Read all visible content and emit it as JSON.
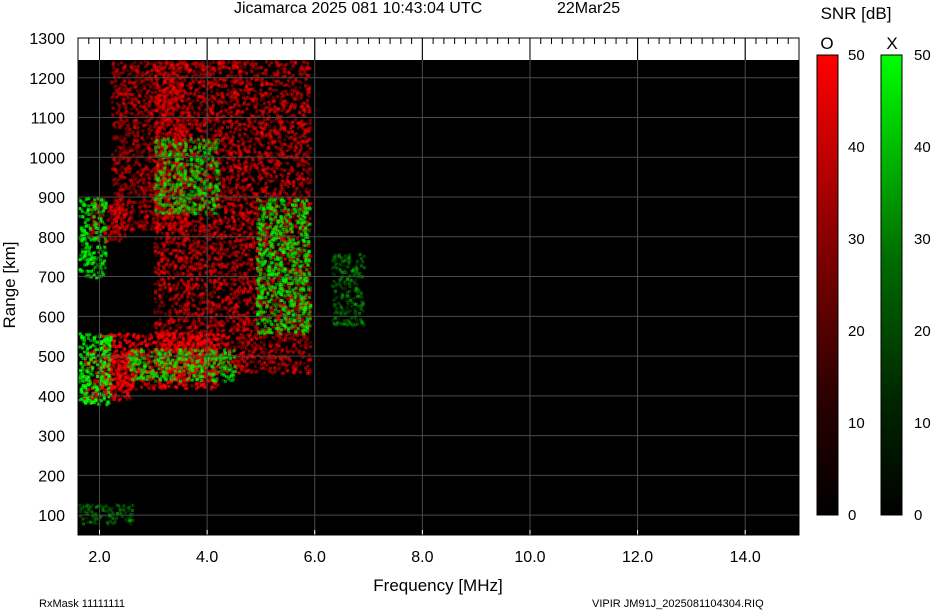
{
  "header": {
    "title": "Jicamarca 2025 081 10:43:04 UTC",
    "date": "22Mar25"
  },
  "footer": {
    "rxmask": "RxMask 11111111",
    "file": "VIPIR  JM91J_2025081104304.RIQ"
  },
  "colorbar": {
    "title": "SNR [dB]",
    "o_label": "O",
    "x_label": "X",
    "ticks": [
      "0",
      "10",
      "20",
      "30",
      "40",
      "50"
    ],
    "o_color": "#ff0000",
    "x_color": "#00ff00"
  },
  "chart_data": {
    "type": "heatmap",
    "title": "Jicamarca 2025 081 10:43:04 UTC",
    "xlabel": "Frequency [MHz]",
    "ylabel": "Range [km]",
    "xlim": [
      1.6,
      15.0
    ],
    "ylim": [
      50,
      1300
    ],
    "xticks": [
      2.0,
      4.0,
      6.0,
      8.0,
      10.0,
      12.0,
      14.0
    ],
    "xtick_labels": [
      "2.0",
      "4.0",
      "6.0",
      "8.0",
      "10.0",
      "12.0",
      "14.0"
    ],
    "yticks": [
      100,
      200,
      300,
      400,
      500,
      600,
      700,
      800,
      900,
      1000,
      1100,
      1200,
      1300
    ],
    "ytick_labels": [
      "100",
      "200",
      "300",
      "400",
      "500",
      "600",
      "700",
      "800",
      "900",
      "1000",
      "1100",
      "1200",
      "1300"
    ],
    "data_range_max_km": 1245,
    "grid": true,
    "background": "#000000",
    "series": [
      {
        "name": "O",
        "color": "#ff0000",
        "snr_range_db": [
          0,
          50
        ],
        "regions": [
          {
            "f": [
              1.7,
              2.6
            ],
            "range_km": [
              390,
              520
            ],
            "snr_db": 40
          },
          {
            "f": [
              2.0,
              4.2
            ],
            "range_km": [
              420,
              560
            ],
            "snr_db": 45
          },
          {
            "f": [
              3.0,
              5.9
            ],
            "range_km": [
              460,
              1245
            ],
            "snr_db": 30
          },
          {
            "f": [
              2.2,
              3.6
            ],
            "range_km": [
              820,
              1245
            ],
            "snr_db": 25
          },
          {
            "f": [
              1.8,
              2.5
            ],
            "range_km": [
              790,
              900
            ],
            "snr_db": 30
          }
        ]
      },
      {
        "name": "X",
        "color": "#00ff00",
        "snr_range_db": [
          0,
          50
        ],
        "regions": [
          {
            "f": [
              1.6,
              2.2
            ],
            "range_km": [
              380,
              560
            ],
            "snr_db": 45
          },
          {
            "f": [
              1.6,
              2.1
            ],
            "range_km": [
              700,
              900
            ],
            "snr_db": 40
          },
          {
            "f": [
              2.5,
              4.5
            ],
            "range_km": [
              440,
              520
            ],
            "snr_db": 35
          },
          {
            "f": [
              3.0,
              4.2
            ],
            "range_km": [
              860,
              1050
            ],
            "snr_db": 30
          },
          {
            "f": [
              4.9,
              5.9
            ],
            "range_km": [
              560,
              900
            ],
            "snr_db": 35
          },
          {
            "f": [
              6.3,
              6.9
            ],
            "range_km": [
              580,
              760
            ],
            "snr_db": 15
          },
          {
            "f": [
              1.6,
              2.6
            ],
            "range_km": [
              80,
              130
            ],
            "snr_db": 15
          }
        ]
      }
    ]
  }
}
